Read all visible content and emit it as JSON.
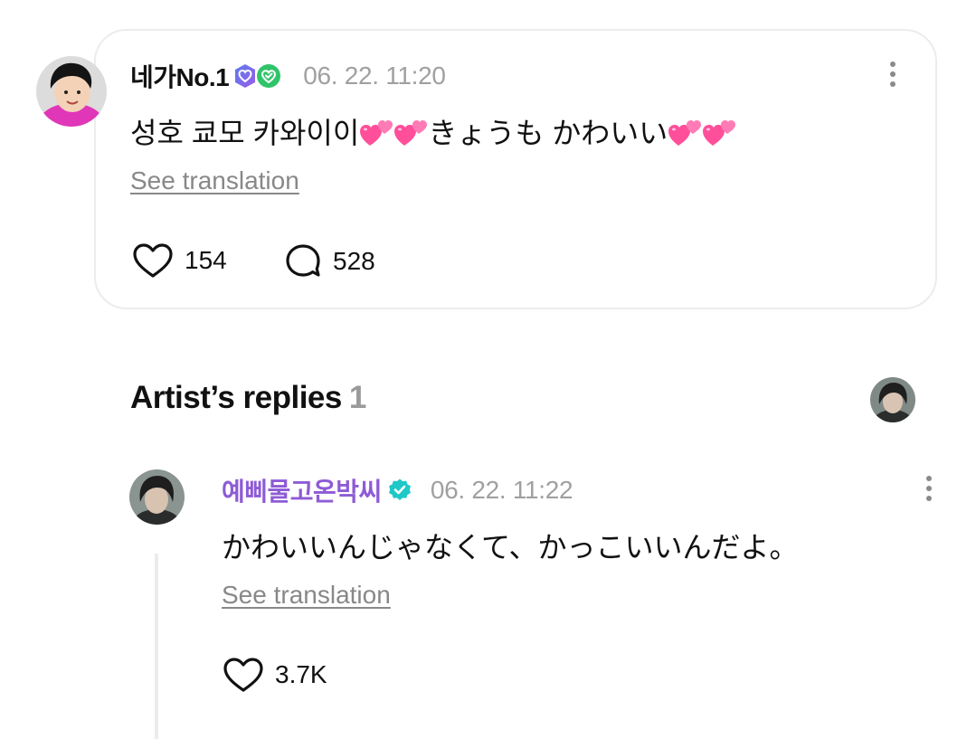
{
  "fan_comment": {
    "username": "네가No.1",
    "timestamp": "06. 22. 11:20",
    "text": "성호 쿄모 카와이이💕💕きょうも かわいい💕💕",
    "text_parts": [
      "성호 쿄모 카와이이",
      "きょうも かわいい"
    ],
    "see_translation": "See translation",
    "likes": "154",
    "comments": "528",
    "badges": [
      "membership-badge",
      "verified-heart-badge"
    ]
  },
  "artist_replies": {
    "title": "Artist’s replies",
    "count": "1"
  },
  "artist_reply": {
    "username": "예삐물고온박씨",
    "timestamp": "06. 22. 11:22",
    "text": "かわいいんじゃなくて、かっこいいんだよ。",
    "see_translation": "See translation",
    "likes": "3.7K"
  },
  "colors": {
    "artist_name": "#8e5bd6",
    "verified_badge": "#1fc8c8",
    "muted_text": "#a0a0a0",
    "card_border": "#ececec",
    "emoji_heart": "#ff4f9a"
  },
  "icons": [
    "more-vertical-icon",
    "heart-outline-icon",
    "comment-bubble-icon",
    "verified-check-icon",
    "two-hearts-emoji"
  ]
}
